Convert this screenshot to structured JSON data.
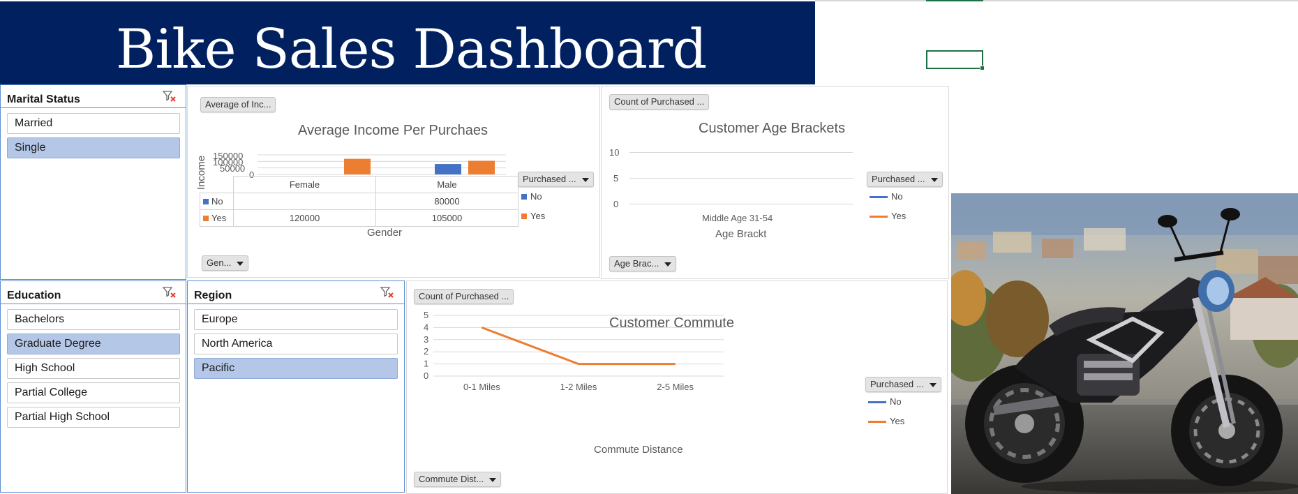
{
  "dashboard": {
    "title": "Bike Sales Dashboard"
  },
  "slicers": {
    "marital_status": {
      "title": "Marital Status",
      "items": [
        {
          "label": "Married",
          "selected": false
        },
        {
          "label": "Single",
          "selected": true
        }
      ]
    },
    "education": {
      "title": "Education",
      "items": [
        {
          "label": "Bachelors",
          "selected": false
        },
        {
          "label": "Graduate Degree",
          "selected": true
        },
        {
          "label": "High School",
          "selected": false
        },
        {
          "label": "Partial College",
          "selected": false
        },
        {
          "label": "Partial High School",
          "selected": false
        }
      ]
    },
    "region": {
      "title": "Region",
      "items": [
        {
          "label": "Europe",
          "selected": false
        },
        {
          "label": "North America",
          "selected": false
        },
        {
          "label": "Pacific",
          "selected": true
        }
      ]
    }
  },
  "field_buttons": {
    "income_value": "Average of Inc...",
    "income_legend": "Purchased ...",
    "income_axis": "Gen...",
    "age_value": "Count of Purchased ...",
    "age_legend": "Purchased ...",
    "age_axis": "Age Brac...",
    "commute_value": "Count of Purchased ...",
    "commute_legend": "Purchased ...",
    "commute_axis": "Commute Dist..."
  },
  "colors": {
    "banner": "#002060",
    "no_series": "#4472c4",
    "yes_series": "#ed7d31",
    "slicer_selected": "#b4c7e7",
    "cell_selection": "#1e7145"
  },
  "photo": {
    "icon": "motorcycle-photo"
  },
  "chart_data": [
    {
      "type": "bar",
      "title": "Average Income Per Purchaes",
      "xlabel": "Gender",
      "ylabel": "Income",
      "categories": [
        "Female",
        "Male"
      ],
      "yticks": [
        "150000",
        "100000",
        "50000",
        "0"
      ],
      "ylim": [
        0,
        150000
      ],
      "series": [
        {
          "name": "No",
          "values": [
            null,
            80000
          ],
          "value_labels": [
            "",
            "80000"
          ]
        },
        {
          "name": "Yes",
          "values": [
            120000,
            105000
          ],
          "value_labels": [
            "120000",
            "105000"
          ]
        }
      ],
      "data_table": true,
      "legend": "right"
    },
    {
      "type": "line",
      "title": "Customer Age Brackets",
      "xlabel": "Age Brackt",
      "categories": [
        "Middle Age 31-54"
      ],
      "yticks": [
        "10",
        "5",
        "0"
      ],
      "ylim": [
        0,
        10
      ],
      "series": [
        {
          "name": "No",
          "values": [
            null
          ]
        },
        {
          "name": "Yes",
          "values": [
            null
          ]
        }
      ],
      "legend": "right"
    },
    {
      "type": "line",
      "title": "Customer Commute",
      "xlabel": "Commute Distance",
      "categories": [
        "0-1 Miles",
        "1-2 Miles",
        "2-5 Miles"
      ],
      "yticks": [
        "5",
        "4",
        "3",
        "2",
        "1",
        "0"
      ],
      "ylim": [
        0,
        5
      ],
      "series": [
        {
          "name": "No",
          "values": [
            null,
            null,
            null
          ]
        },
        {
          "name": "Yes",
          "values": [
            4,
            1,
            1
          ]
        }
      ],
      "legend": "right"
    }
  ]
}
